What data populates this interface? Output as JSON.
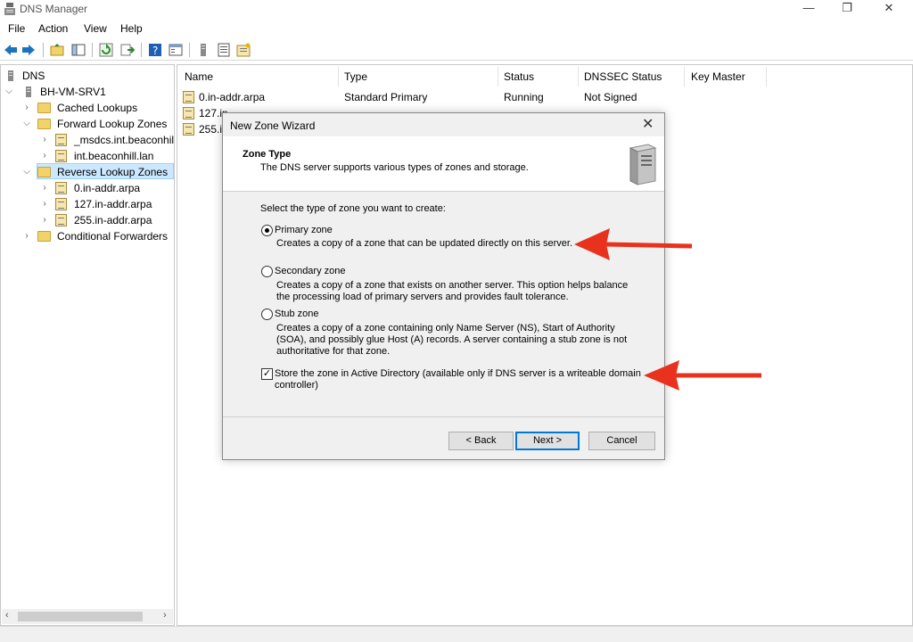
{
  "window": {
    "title": "DNS Manager",
    "minimize": "—",
    "maximize": "❐",
    "close": "✕"
  },
  "menu": [
    "File",
    "Action",
    "View",
    "Help"
  ],
  "toolbar_icons": [
    "back-icon",
    "forward-icon",
    "up-folder-icon",
    "show-hide-tree-icon",
    "refresh-icon",
    "export-icon",
    "help-icon",
    "properties-icon",
    "server-icon",
    "list-icon",
    "new-zone-icon"
  ],
  "tree": {
    "root": "DNS",
    "server": "BH-VM-SRV1",
    "items": {
      "cached": "Cached Lookups",
      "forward": "Forward Lookup Zones",
      "fwd_zone1": "_msdcs.int.beaconhil",
      "fwd_zone2": "int.beaconhill.lan",
      "reverse": "Reverse Lookup Zones",
      "rev_zone1": "0.in-addr.arpa",
      "rev_zone2": "127.in-addr.arpa",
      "rev_zone3": "255.in-addr.arpa",
      "conditional": "Conditional Forwarders"
    }
  },
  "list": {
    "columns": [
      "Name",
      "Type",
      "Status",
      "DNSSEC Status",
      "Key Master"
    ],
    "rows": [
      {
        "name": "0.in-addr.arpa",
        "type": "Standard Primary",
        "status": "Running",
        "dnssec": "Not Signed"
      },
      {
        "name": "127.in-",
        "type": "",
        "status": "",
        "dnssec": ""
      },
      {
        "name": "255.in",
        "type": "",
        "status": "",
        "dnssec": ""
      }
    ]
  },
  "dialog": {
    "title": "New Zone Wizard",
    "close": "✕",
    "header_title": "Zone Type",
    "header_subtitle": "The DNS server supports various types of zones and storage.",
    "prompt": "Select the type of zone you want to create:",
    "options": {
      "primary": {
        "label": "Primary zone",
        "desc": "Creates a copy of a zone that can be updated directly on this server.",
        "selected": true
      },
      "secondary": {
        "label": "Secondary zone",
        "desc1": "Creates a copy of a zone that exists on another server. This option helps balance",
        "desc2": "the processing load of primary servers and provides fault tolerance.",
        "selected": false
      },
      "stub": {
        "label": "Stub zone",
        "desc1": "Creates a copy of a zone containing only Name Server (NS), Start of Authority",
        "desc2": "(SOA), and possibly glue Host (A) records. A server containing a stub zone is not",
        "desc3": "authoritative for that zone.",
        "selected": false
      }
    },
    "store_ad": {
      "label1": "Store the zone in Active Directory (available only if DNS server is a writeable domain",
      "label2": "controller)",
      "checked": true,
      "mark": "✓"
    },
    "buttons": {
      "back": "< Back",
      "next": "Next >",
      "cancel": "Cancel"
    }
  },
  "colors": {
    "annotation_arrow": "#e8321e",
    "selection": "#cce8ff",
    "folder": "#f2d36a"
  }
}
